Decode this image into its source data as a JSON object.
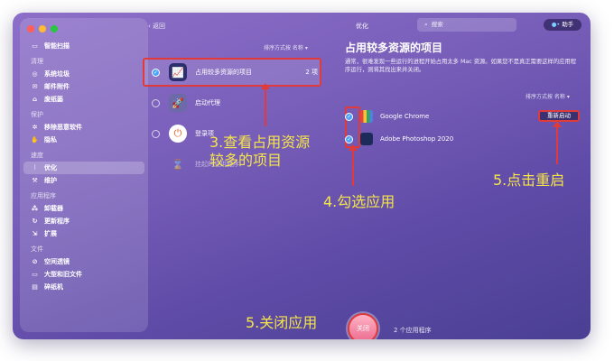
{
  "sidebar": {
    "smart_scan": "智能扫描",
    "sections": [
      {
        "title": "清理",
        "items": [
          "系统垃圾",
          "邮件附件",
          "废纸篓"
        ]
      },
      {
        "title": "保护",
        "items": [
          "移除恶意软件",
          "隐私"
        ]
      },
      {
        "title": "速度",
        "items": [
          "优化",
          "维护"
        ]
      },
      {
        "title": "应用程序",
        "items": [
          "卸载器",
          "更新程序",
          "扩展"
        ]
      },
      {
        "title": "文件",
        "items": [
          "空间透镜",
          "大型和旧文件",
          "碎纸机"
        ]
      }
    ]
  },
  "topbar": {
    "back": "返回",
    "title": "优化",
    "search_placeholder": "搜索",
    "assistant": "助手"
  },
  "middle": {
    "sort_label": "排序方式按 名称",
    "items": [
      {
        "label": "占用较多资源的项目",
        "count": "2 项"
      },
      {
        "label": "启动代理"
      },
      {
        "label": "登录项"
      },
      {
        "label": "挂起的应用程序"
      }
    ]
  },
  "right": {
    "title": "占用较多资源的项目",
    "description": "通常，很难发现一些运行的进程开始占用太多 Mac 资源。如果您不是真正需要这样的应用程序运行，则将其找出来并关闭。",
    "sort_label": "排序方式按 名称",
    "apps": [
      {
        "name": "Google Chrome"
      },
      {
        "name": "Adobe Photoshop 2020"
      }
    ],
    "restart_label": "重新启动"
  },
  "footer": {
    "close_label": "关闭",
    "info": "2 个应用程序"
  },
  "annotations": {
    "step3": "3.查看占用资源\n较多的项目",
    "step4": "4.勾选应用",
    "step5_restart": "5.点击重启",
    "step5_close": "5.关闭应用"
  }
}
